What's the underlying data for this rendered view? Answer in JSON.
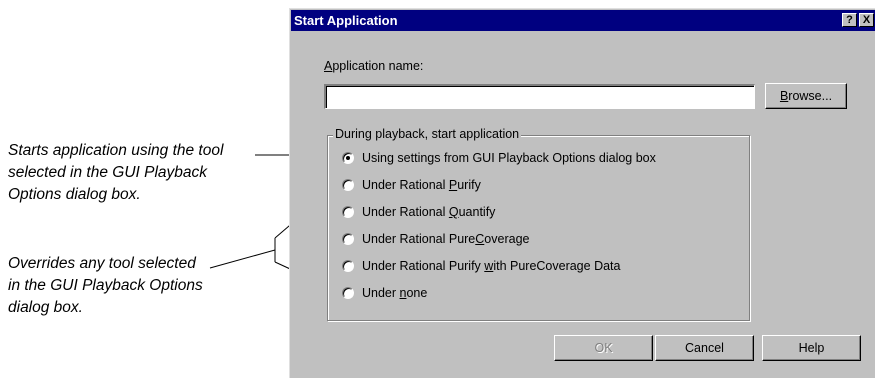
{
  "callouts": [
    "Starts application using the tool selected in the GUI Playback Options dialog box.",
    "Overrides any tool selected in the GUI Playback Options dialog box."
  ],
  "dialog": {
    "title": "Start Application",
    "help_button": "?",
    "close_button": "X",
    "app_name_label": {
      "mnemonic": "A",
      "rest": "pplication name:"
    },
    "app_name_value": "",
    "browse": {
      "mnemonic": "B",
      "rest": "rowse..."
    },
    "group_label": "During playback, start application",
    "options": [
      {
        "pre": "Using settings from GUI Playback Options dialog box",
        "mn": "",
        "post": "",
        "checked": true
      },
      {
        "pre": "Under Rational ",
        "mn": "P",
        "post": "urify",
        "checked": false
      },
      {
        "pre": "Under Rational ",
        "mn": "Q",
        "post": "uantify",
        "checked": false
      },
      {
        "pre": "Under Rational Pure",
        "mn": "C",
        "post": "overage",
        "checked": false
      },
      {
        "pre": "Under Rational Purify ",
        "mn": "w",
        "post": "ith PureCoverage Data",
        "checked": false
      },
      {
        "pre": "Under ",
        "mn": "n",
        "post": "one",
        "checked": false
      }
    ],
    "buttons": {
      "ok": "OK",
      "cancel": "Cancel",
      "help": "Help"
    }
  }
}
